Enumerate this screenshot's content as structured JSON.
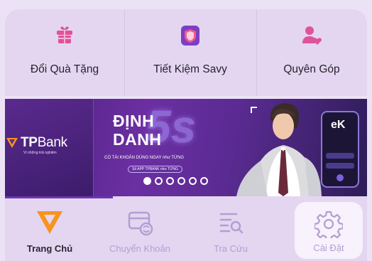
{
  "quick_actions": [
    {
      "label": "Đổi Quà Tặng",
      "icon": "gift-icon"
    },
    {
      "label": "Tiết Kiệm Savy",
      "icon": "shield-savings-icon"
    },
    {
      "label": "Quyên Góp",
      "icon": "donate-heart-icon"
    }
  ],
  "banner": {
    "brand": "TPBank",
    "brand_tp": "TP",
    "brand_bank": "Bank",
    "slogan": "Vì những trải nghiệm",
    "headline_line1": "ĐỊNH",
    "headline_line2": "DANH",
    "headline_accent": "5s",
    "subline": "CÓ TÀI KHOẢN DÙNG NGAY như TỪNG",
    "cta_badge": "Số APP TPBANK như TỪNG",
    "screen_text": "eK",
    "slide_count": 6,
    "active_slide": 1
  },
  "bottom_nav": [
    {
      "label": "Trang Chủ",
      "icon": "home-logo-icon",
      "active": true
    },
    {
      "label": "Chuyển Khoản",
      "icon": "transfer-icon",
      "active": false
    },
    {
      "label": "Tra Cứu",
      "icon": "search-list-icon",
      "active": false
    },
    {
      "label": "Cài Đặt",
      "icon": "gear-icon",
      "active": false
    }
  ],
  "colors": {
    "background": "#ece2f5",
    "card": "#e4d6f1",
    "accent_orange": "#f7941d",
    "accent_purple": "#6b35b3",
    "icon_pink": "#e0529c",
    "inactive_text": "#b39ed2"
  }
}
